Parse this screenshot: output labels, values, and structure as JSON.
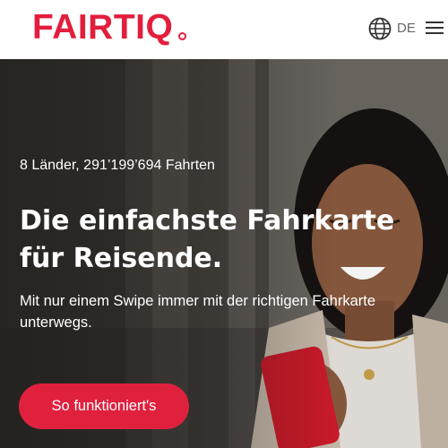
{
  "header": {
    "logo_text": "FAIRTIQ",
    "language": "DE",
    "globe_icon": "globe-icon",
    "menu_icon": "hamburger-menu-icon"
  },
  "hero": {
    "stats": "8 Länder, 291’199’694 Fahrten",
    "headline": "Die einfachste Fahrkarte für Reisende.",
    "subtitle": "Mit nur einem Swipe immer mit der richtigen Fahrkarte unterwegs.",
    "cta_label": "So funktioniert's"
  },
  "colors": {
    "brand": "#e31e3c",
    "cta_background": "#e0213e",
    "hero_text": "#ffffff"
  }
}
